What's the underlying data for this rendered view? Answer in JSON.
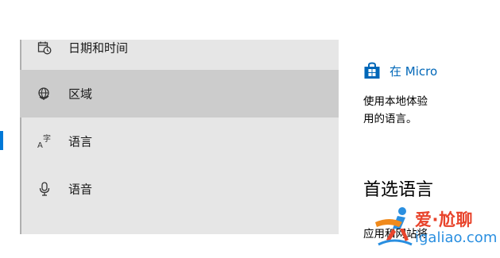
{
  "nav": {
    "items": [
      {
        "label": "日期和时间",
        "icon": "calendar-clock-icon"
      },
      {
        "label": "区域",
        "icon": "globe-icon"
      },
      {
        "label": "语言",
        "icon": "language-icon"
      },
      {
        "label": "语音",
        "icon": "microphone-icon"
      }
    ],
    "language_icon_glyph": "A字",
    "hovered_item": "区域",
    "selected_item": "语言"
  },
  "content": {
    "store_link": "在 Micro",
    "store_icon": "store-bag-icon",
    "description_line1": "使用本地体验",
    "description_line2": "用的语言。",
    "section_title": "首选语言",
    "section_subtitle": "应用和网站将"
  },
  "watermark": {
    "title": "爱·尬聊",
    "url": "igaliao.com"
  },
  "colors": {
    "nav_background": "#e6e6e6",
    "hover_background": "#cccccc",
    "accent": "#0078d7",
    "link": "#0067b8",
    "watermark_red": "#e8442c",
    "watermark_blue": "#2a8fe0"
  }
}
